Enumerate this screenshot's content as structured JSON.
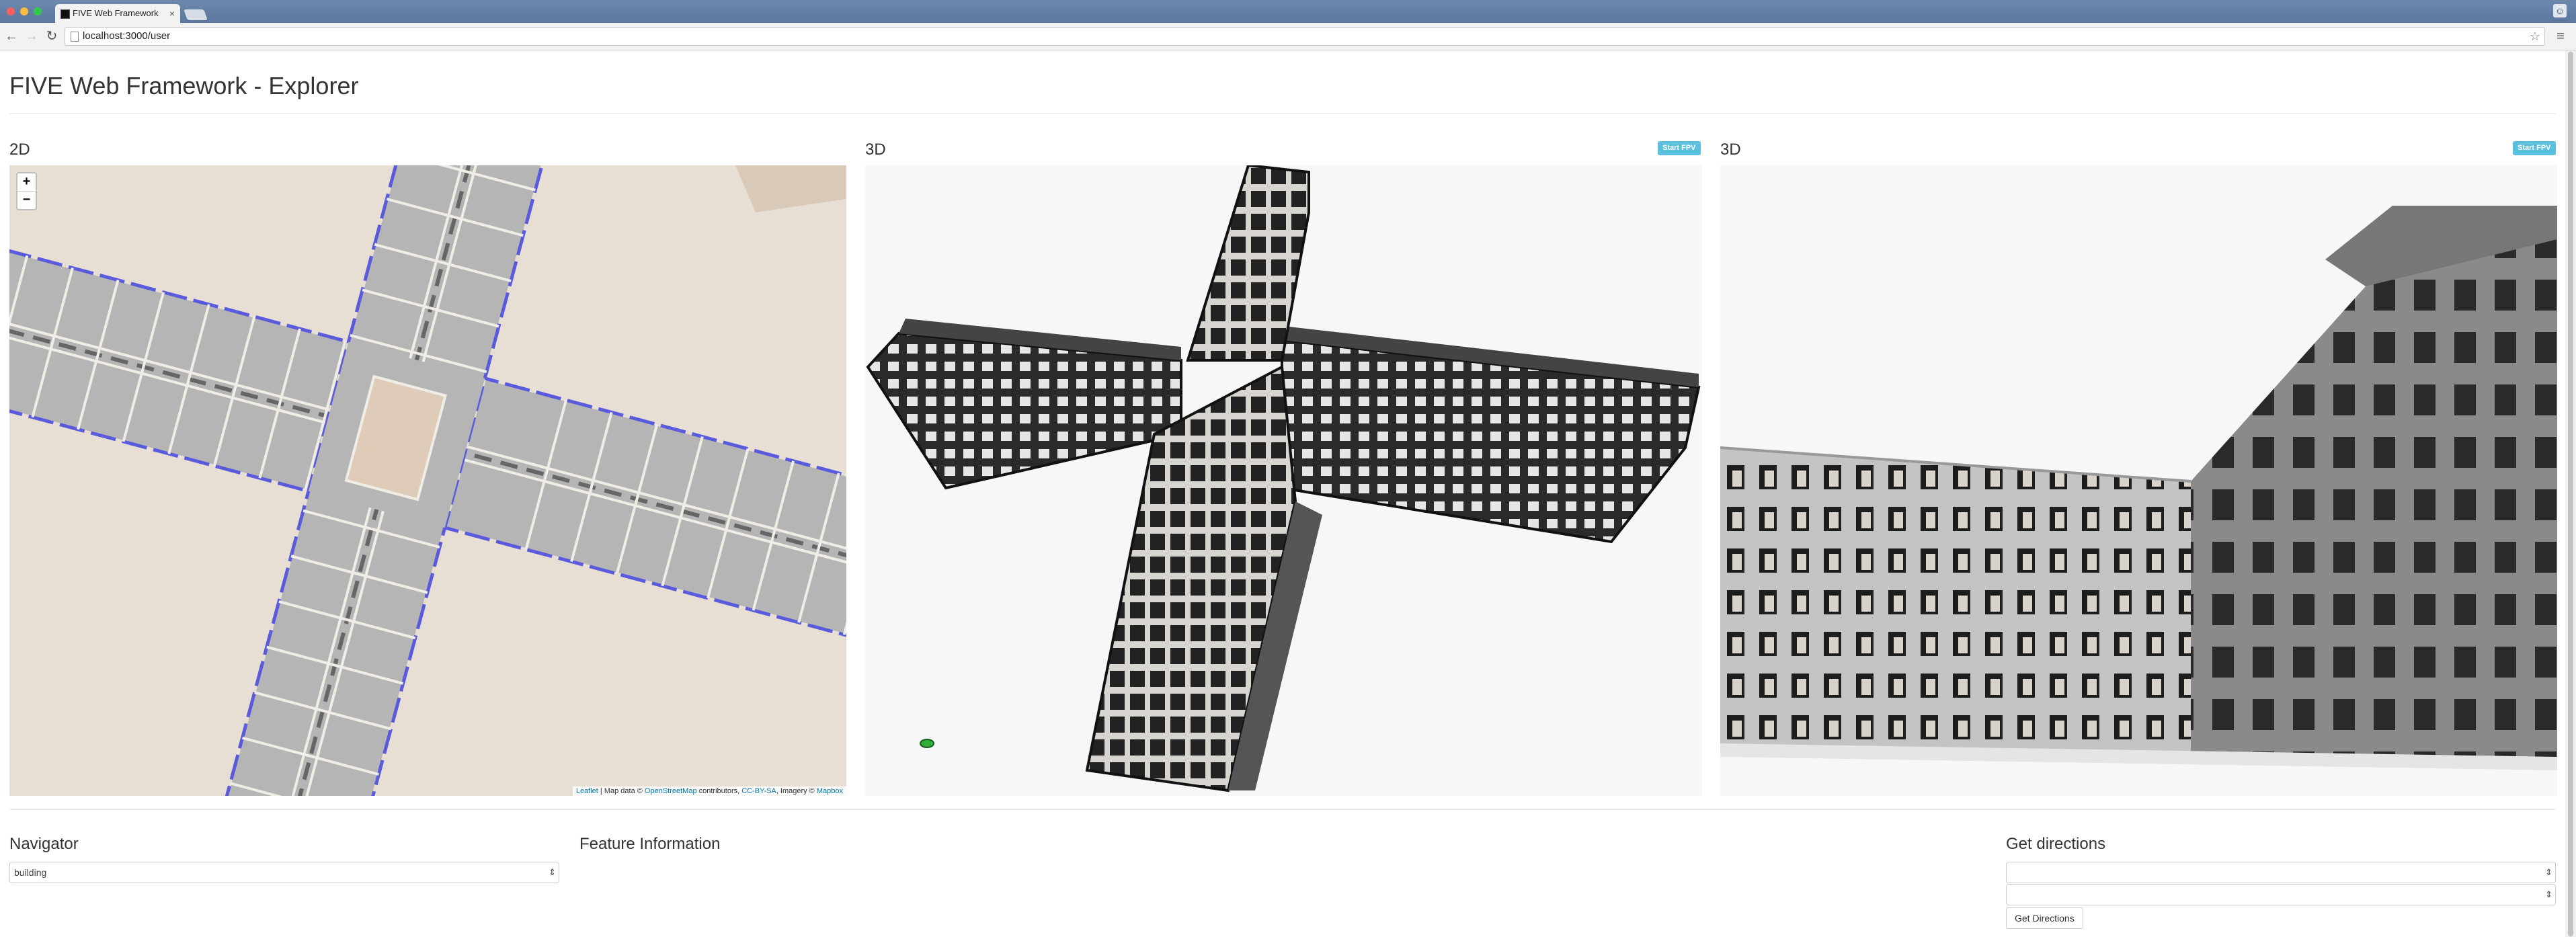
{
  "browser": {
    "tab_title": "FIVE Web Framework - Ex",
    "tab_close": "×",
    "url": "localhost:3000/user",
    "back": "←",
    "forward": "→",
    "reload": "↻",
    "star": "☆",
    "menu": "≡",
    "profile": "☺"
  },
  "page": {
    "title": "FIVE Web Framework - Explorer"
  },
  "panels": {
    "map": {
      "title": "2D",
      "zoom_in": "+",
      "zoom_out": "−",
      "attribution": {
        "leaflet": "Leaflet",
        "sep1": " | Map data © ",
        "osm": "OpenStreetMap",
        "sep2": " contributors, ",
        "license": "CC-BY-SA",
        "sep3": ", Imagery © ",
        "mapbox": "Mapbox"
      }
    },
    "view1": {
      "title": "3D",
      "fpv_label": "Start FPV"
    },
    "view2": {
      "title": "3D",
      "fpv_label": "Start FPV"
    }
  },
  "navigator": {
    "title": "Navigator",
    "selected": "building"
  },
  "feature_info": {
    "title": "Feature Information"
  },
  "directions": {
    "title": "Get directions",
    "from_value": "",
    "to_value": "",
    "button_label": "Get Directions"
  },
  "colors": {
    "map_background": "#e8dfd4",
    "room_fill": "#b5b5b5",
    "wall_outline": "#5a5adc",
    "fpv_button": "#5bc0de"
  }
}
